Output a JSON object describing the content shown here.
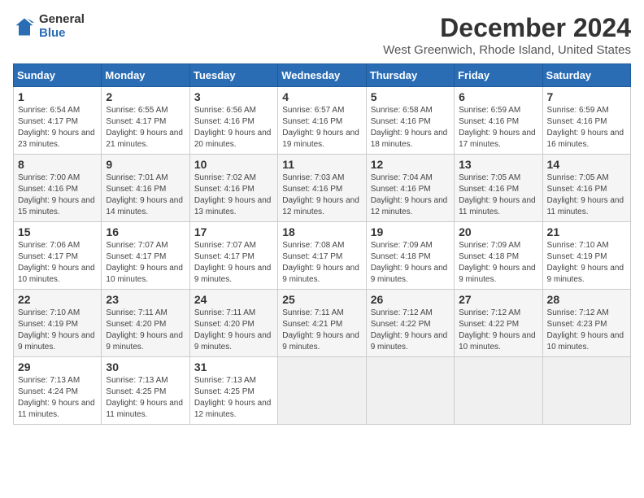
{
  "logo": {
    "general": "General",
    "blue": "Blue"
  },
  "title": "December 2024",
  "subtitle": "West Greenwich, Rhode Island, United States",
  "days_of_week": [
    "Sunday",
    "Monday",
    "Tuesday",
    "Wednesday",
    "Thursday",
    "Friday",
    "Saturday"
  ],
  "weeks": [
    [
      {
        "day": "1",
        "sunrise": "6:54 AM",
        "sunset": "4:17 PM",
        "daylight": "9 hours and 23 minutes."
      },
      {
        "day": "2",
        "sunrise": "6:55 AM",
        "sunset": "4:17 PM",
        "daylight": "9 hours and 21 minutes."
      },
      {
        "day": "3",
        "sunrise": "6:56 AM",
        "sunset": "4:16 PM",
        "daylight": "9 hours and 20 minutes."
      },
      {
        "day": "4",
        "sunrise": "6:57 AM",
        "sunset": "4:16 PM",
        "daylight": "9 hours and 19 minutes."
      },
      {
        "day": "5",
        "sunrise": "6:58 AM",
        "sunset": "4:16 PM",
        "daylight": "9 hours and 18 minutes."
      },
      {
        "day": "6",
        "sunrise": "6:59 AM",
        "sunset": "4:16 PM",
        "daylight": "9 hours and 17 minutes."
      },
      {
        "day": "7",
        "sunrise": "6:59 AM",
        "sunset": "4:16 PM",
        "daylight": "9 hours and 16 minutes."
      }
    ],
    [
      {
        "day": "8",
        "sunrise": "7:00 AM",
        "sunset": "4:16 PM",
        "daylight": "9 hours and 15 minutes."
      },
      {
        "day": "9",
        "sunrise": "7:01 AM",
        "sunset": "4:16 PM",
        "daylight": "9 hours and 14 minutes."
      },
      {
        "day": "10",
        "sunrise": "7:02 AM",
        "sunset": "4:16 PM",
        "daylight": "9 hours and 13 minutes."
      },
      {
        "day": "11",
        "sunrise": "7:03 AM",
        "sunset": "4:16 PM",
        "daylight": "9 hours and 12 minutes."
      },
      {
        "day": "12",
        "sunrise": "7:04 AM",
        "sunset": "4:16 PM",
        "daylight": "9 hours and 12 minutes."
      },
      {
        "day": "13",
        "sunrise": "7:05 AM",
        "sunset": "4:16 PM",
        "daylight": "9 hours and 11 minutes."
      },
      {
        "day": "14",
        "sunrise": "7:05 AM",
        "sunset": "4:16 PM",
        "daylight": "9 hours and 11 minutes."
      }
    ],
    [
      {
        "day": "15",
        "sunrise": "7:06 AM",
        "sunset": "4:17 PM",
        "daylight": "9 hours and 10 minutes."
      },
      {
        "day": "16",
        "sunrise": "7:07 AM",
        "sunset": "4:17 PM",
        "daylight": "9 hours and 10 minutes."
      },
      {
        "day": "17",
        "sunrise": "7:07 AM",
        "sunset": "4:17 PM",
        "daylight": "9 hours and 9 minutes."
      },
      {
        "day": "18",
        "sunrise": "7:08 AM",
        "sunset": "4:17 PM",
        "daylight": "9 hours and 9 minutes."
      },
      {
        "day": "19",
        "sunrise": "7:09 AM",
        "sunset": "4:18 PM",
        "daylight": "9 hours and 9 minutes."
      },
      {
        "day": "20",
        "sunrise": "7:09 AM",
        "sunset": "4:18 PM",
        "daylight": "9 hours and 9 minutes."
      },
      {
        "day": "21",
        "sunrise": "7:10 AM",
        "sunset": "4:19 PM",
        "daylight": "9 hours and 9 minutes."
      }
    ],
    [
      {
        "day": "22",
        "sunrise": "7:10 AM",
        "sunset": "4:19 PM",
        "daylight": "9 hours and 9 minutes."
      },
      {
        "day": "23",
        "sunrise": "7:11 AM",
        "sunset": "4:20 PM",
        "daylight": "9 hours and 9 minutes."
      },
      {
        "day": "24",
        "sunrise": "7:11 AM",
        "sunset": "4:20 PM",
        "daylight": "9 hours and 9 minutes."
      },
      {
        "day": "25",
        "sunrise": "7:11 AM",
        "sunset": "4:21 PM",
        "daylight": "9 hours and 9 minutes."
      },
      {
        "day": "26",
        "sunrise": "7:12 AM",
        "sunset": "4:22 PM",
        "daylight": "9 hours and 9 minutes."
      },
      {
        "day": "27",
        "sunrise": "7:12 AM",
        "sunset": "4:22 PM",
        "daylight": "9 hours and 10 minutes."
      },
      {
        "day": "28",
        "sunrise": "7:12 AM",
        "sunset": "4:23 PM",
        "daylight": "9 hours and 10 minutes."
      }
    ],
    [
      {
        "day": "29",
        "sunrise": "7:13 AM",
        "sunset": "4:24 PM",
        "daylight": "9 hours and 11 minutes."
      },
      {
        "day": "30",
        "sunrise": "7:13 AM",
        "sunset": "4:25 PM",
        "daylight": "9 hours and 11 minutes."
      },
      {
        "day": "31",
        "sunrise": "7:13 AM",
        "sunset": "4:25 PM",
        "daylight": "9 hours and 12 minutes."
      },
      null,
      null,
      null,
      null
    ]
  ],
  "labels": {
    "sunrise": "Sunrise:",
    "sunset": "Sunset:",
    "daylight": "Daylight:"
  }
}
